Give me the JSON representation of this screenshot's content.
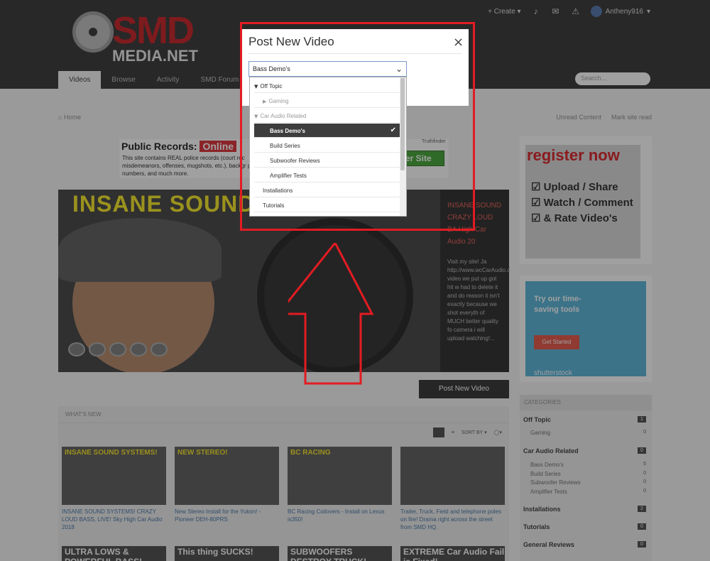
{
  "header": {
    "logo_text": "SMD",
    "logo_subtext": "MEDIA.NET",
    "create_label": "+ Create ▾",
    "bell_icon": "bell-icon",
    "mail_icon": "mail-icon",
    "alert_icon": "alert-icon",
    "username": "Antheny916",
    "nav_tabs": [
      "Videos",
      "Browse",
      "Activity",
      "SMD Forum"
    ],
    "search_placeholder": "Search..."
  },
  "breadcrumb": "Home",
  "right_links": [
    "Unread Content",
    "Mark site read"
  ],
  "ad": {
    "title": "Public Records:",
    "badge": "Online",
    "body": "This site contains REAL police records (court rec misdemeanors, offenses, mugshots, etc.), backgr phone numbers, and much more.",
    "label": "Truthfinder",
    "button": "er Site"
  },
  "video": {
    "banner": "INSANE SOUND SYSTEMS",
    "desc_title": "INSANE SOUND CRAZY LOUD BA High Car Audio 20",
    "desc_text": "Visit my site! Ja http://www.wcCarAudio.c video we put up got hit w had to delete it and do reason it isn't exactly because we shot everyth of MUCH better quality fo camera i will upload watching!..."
  },
  "post_new_video_button": "Post New Video",
  "whats_new": {
    "header": "WHAT'S NEW",
    "sort": "SORT BY ▾",
    "cards": [
      {
        "img_label": "INSANE SOUND SYSTEMS!",
        "title": "INSANE SOUND SYSTEMS! CRAZY LOUD BASS, LIVE! Sky High Car Audio 2018"
      },
      {
        "img_label": "NEW STEREO!",
        "title": "New Stereo Install for the Yukon! - Pioneer DEH-80PRS"
      },
      {
        "img_label": "BC RACING",
        "title": "BC Racing Coilovers - Install on Lexus is350!"
      },
      {
        "img_label": "",
        "title": "Trailer, Truck, Field and telephone poles on fire! Drama right across the street from SMD HQ."
      }
    ],
    "cards_row2": [
      "ULTRA LOWS & POWERFUL BASS!",
      "This thing SUCKS!",
      "SUBWOOFERS DESTROY TRUCK!",
      "EXTREME Car Audio Fail is Fixed!"
    ]
  },
  "sidebar": {
    "register": {
      "title": "register now",
      "lines": [
        "☑ Upload / Share",
        "☑ Watch / Comment",
        "☑ & Rate Video's"
      ]
    },
    "shutterstock": {
      "headline": "Try our time-saving tools",
      "button": "Get Started",
      "brand": "shutterstock"
    },
    "categories": {
      "header": "CATEGORIES",
      "items": [
        {
          "name": "Off Topic",
          "count": "1",
          "subs": [
            {
              "name": "Gaming",
              "count": "0"
            }
          ]
        },
        {
          "name": "Car Audio Related",
          "count": "0",
          "subs": [
            {
              "name": "Bass Demo's",
              "count": "5"
            },
            {
              "name": "Build Series",
              "count": "0"
            },
            {
              "name": "Subwoofer Reviews",
              "count": "0"
            },
            {
              "name": "Amplifier Tests",
              "count": "0"
            }
          ]
        },
        {
          "name": "Installations",
          "count": "2",
          "subs": []
        },
        {
          "name": "Tutorials",
          "count": "0",
          "subs": []
        },
        {
          "name": "General Reviews",
          "count": "0",
          "subs": []
        }
      ]
    }
  },
  "modal": {
    "title": "Post New Video",
    "close": "×",
    "selected_value": "Bass Demo's",
    "chevron_icon": "chevron-down-icon",
    "options": [
      {
        "label": "Off Topic",
        "level": 0,
        "toggle": "▼",
        "muted": false
      },
      {
        "label": "Gaming",
        "level": 1,
        "toggle": "▶",
        "muted": true
      },
      {
        "label": "Car Audio Related",
        "level": 0,
        "toggle": "▼",
        "muted": true
      },
      {
        "label": "Bass Demo's",
        "level": 1,
        "selected": true
      },
      {
        "label": "Build Series",
        "level": 1
      },
      {
        "label": "Subwoofer Reviews",
        "level": 1
      },
      {
        "label": "Amplifier Tests",
        "level": 1
      },
      {
        "label": "Installations",
        "level": 0
      },
      {
        "label": "Tutorials",
        "level": 0
      }
    ],
    "check_icon": "✔"
  },
  "colors": {
    "annotation_red": "#e21c22",
    "header_dark": "#2d2d2d",
    "brand_red": "#c4161c",
    "selected_option_bg": "#3d3d3d"
  }
}
